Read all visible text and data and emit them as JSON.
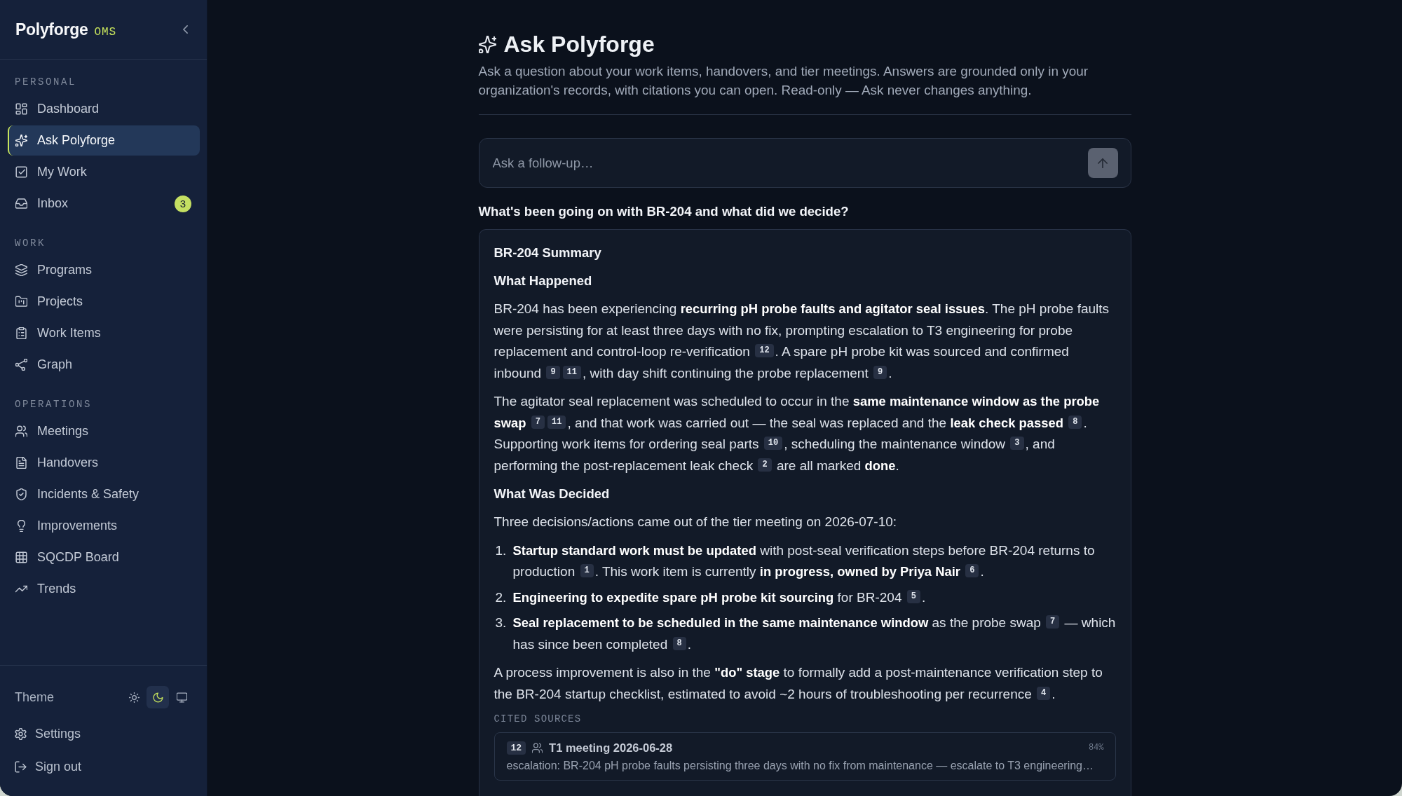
{
  "sidebar": {
    "brand": {
      "name": "Polyforge",
      "tag": "OMS"
    },
    "sections": [
      {
        "label": "PERSONAL",
        "items": [
          {
            "label": "Dashboard",
            "selected": false
          },
          {
            "label": "Ask Polyforge",
            "selected": true
          },
          {
            "label": "My Work",
            "selected": false
          },
          {
            "label": "Inbox",
            "selected": false,
            "badge": "3"
          }
        ]
      },
      {
        "label": "WORK",
        "items": [
          {
            "label": "Programs",
            "selected": false
          },
          {
            "label": "Projects",
            "selected": false
          },
          {
            "label": "Work Items",
            "selected": false
          },
          {
            "label": "Graph",
            "selected": false
          }
        ]
      },
      {
        "label": "OPERATIONS",
        "items": [
          {
            "label": "Meetings",
            "selected": false
          },
          {
            "label": "Handovers",
            "selected": false
          },
          {
            "label": "Incidents & Safety",
            "selected": false
          },
          {
            "label": "Improvements",
            "selected": false
          },
          {
            "label": "SQCDP Board",
            "selected": false
          },
          {
            "label": "Trends",
            "selected": false
          }
        ]
      }
    ],
    "theme": {
      "label": "Theme",
      "options": [
        {
          "selected": false
        },
        {
          "selected": true
        },
        {
          "selected": false
        }
      ]
    },
    "footer_links": [
      "Settings",
      "Sign out"
    ]
  },
  "page": {
    "title": "Ask Polyforge",
    "description": "Ask a question about your work items, handovers, and tier meetings. Answers are grounded only in your organization's records, with citations you can open. Read-only — Ask never changes anything."
  },
  "followup": {
    "placeholder": "Ask a follow-up…",
    "send_disabled": true
  },
  "question": "What's been going on with BR-204 and what did we decide?",
  "answer": {
    "blocks": [
      {
        "kind": "heading",
        "text": "BR-204 Summary"
      },
      {
        "kind": "heading",
        "text": "What Happened"
      },
      {
        "kind": "paragraph",
        "segments": [
          {
            "kind": "text",
            "text": "BR-204 has been experiencing **recurring pH probe faults and agitator seal issues**. The pH probe faults were persisting for at least three days with no fix, prompting escalation to T3 engineering for probe replacement and control-loop re-verification "
          },
          {
            "kind": "cite",
            "text": "12"
          },
          {
            "kind": "text",
            "text": ". A spare pH probe kit was sourced and confirmed inbound "
          },
          {
            "kind": "cite",
            "text": "9"
          },
          {
            "kind": "cite",
            "text": "11"
          },
          {
            "kind": "text",
            "text": ", with day shift continuing the probe replacement "
          },
          {
            "kind": "cite",
            "text": "9"
          },
          {
            "kind": "text",
            "text": "."
          }
        ]
      },
      {
        "kind": "paragraph",
        "segments": [
          {
            "kind": "text",
            "text": "The agitator seal replacement was scheduled to occur in the **same maintenance window as the probe swap** "
          },
          {
            "kind": "cite",
            "text": "7"
          },
          {
            "kind": "cite",
            "text": "11"
          },
          {
            "kind": "text",
            "text": ", and that work was carried out — the seal was replaced and the **leak check passed** "
          },
          {
            "kind": "cite",
            "text": "8"
          },
          {
            "kind": "text",
            "text": ". Supporting work items for ordering seal parts "
          },
          {
            "kind": "cite",
            "text": "10"
          },
          {
            "kind": "text",
            "text": ", scheduling the maintenance window "
          },
          {
            "kind": "cite",
            "text": "3"
          },
          {
            "kind": "text",
            "text": ", and performing the post-replacement leak check "
          },
          {
            "kind": "cite",
            "text": "2"
          },
          {
            "kind": "text",
            "text": " are all marked **done**."
          }
        ]
      },
      {
        "kind": "heading",
        "text": "What Was Decided"
      },
      {
        "kind": "paragraph",
        "segments": [
          {
            "kind": "text",
            "text": "Three decisions/actions came out of the tier meeting on 2026-07-10:"
          }
        ]
      },
      {
        "kind": "list",
        "items": [
          {
            "number": "1.",
            "segments": [
              {
                "kind": "text",
                "text": "**Startup standard work must be updated** with post-seal verification steps before BR-204 returns to production "
              },
              {
                "kind": "cite",
                "text": "1"
              },
              {
                "kind": "text",
                "text": ". This work item is currently **in progress, owned by Priya Nair** "
              },
              {
                "kind": "cite",
                "text": "6"
              },
              {
                "kind": "text",
                "text": "."
              }
            ]
          },
          {
            "number": "2.",
            "segments": [
              {
                "kind": "text",
                "text": "**Engineering to expedite spare pH probe kit sourcing** for BR-204 "
              },
              {
                "kind": "cite",
                "text": "5"
              },
              {
                "kind": "text",
                "text": "."
              }
            ]
          },
          {
            "number": "3.",
            "segments": [
              {
                "kind": "text",
                "text": "**Seal replacement to be scheduled in the same maintenance window** as the probe swap "
              },
              {
                "kind": "cite",
                "text": "7"
              },
              {
                "kind": "text",
                "text": " — which has since been completed "
              },
              {
                "kind": "cite",
                "text": "8"
              },
              {
                "kind": "text",
                "text": "."
              }
            ]
          }
        ]
      },
      {
        "kind": "paragraph",
        "segments": [
          {
            "kind": "text",
            "text": "A process improvement is also in the **\"do\" stage** to formally add a post-maintenance verification step to the BR-204 startup checklist, estimated to avoid ~2 hours of troubleshooting per recurrence "
          },
          {
            "kind": "cite",
            "text": "4"
          },
          {
            "kind": "text",
            "text": "."
          }
        ]
      }
    ],
    "sources_label": "CITED SOURCES",
    "sources": [
      {
        "kind": "meeting",
        "cite": "12",
        "title": "T1 meeting 2026-06-28",
        "score": "84%",
        "snippet": "escalation: BR-204 pH probe faults persisting three days with no fix from maintenance — escalate to T3 engineering…"
      }
    ]
  }
}
